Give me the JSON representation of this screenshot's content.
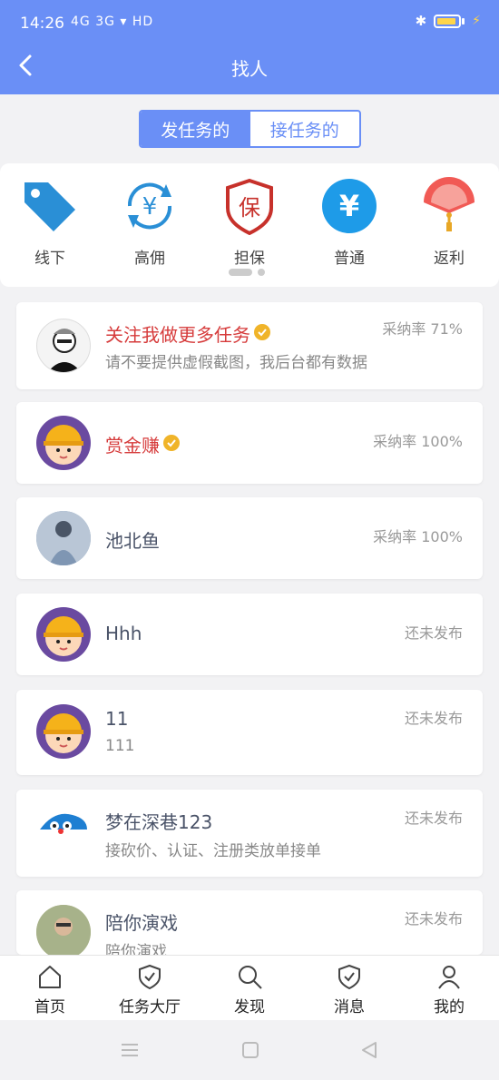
{
  "status_bar": {
    "time": "14:26",
    "signal_text": "4G 3G",
    "network": "HD"
  },
  "header": {
    "title": "找人"
  },
  "segment": {
    "tabs": [
      "发任务的",
      "接任务的"
    ],
    "active_index": 0
  },
  "categories": [
    {
      "label": "线下",
      "icon": "tag-icon"
    },
    {
      "label": "高佣",
      "icon": "yuan-refresh-icon"
    },
    {
      "label": "担保",
      "icon": "guarantee-shield-icon"
    },
    {
      "label": "普通",
      "icon": "yuan-circle-icon"
    },
    {
      "label": "返利",
      "icon": "fan-icon"
    }
  ],
  "users": [
    {
      "name": "关注我做更多任务",
      "verified": true,
      "red": true,
      "sub": "请不要提供虚假截图，我后台都有数据",
      "rate": "采纳率 71%"
    },
    {
      "name": "赏金赚",
      "verified": true,
      "red": true,
      "sub": "",
      "rate": "采纳率 100%"
    },
    {
      "name": "池北鱼",
      "verified": false,
      "red": false,
      "sub": "",
      "rate": "采纳率 100%"
    },
    {
      "name": "Hhh",
      "verified": false,
      "red": false,
      "sub": "",
      "rate": "还未发布"
    },
    {
      "name": "11",
      "verified": false,
      "red": false,
      "sub": "111",
      "rate": "还未发布"
    },
    {
      "name": "梦在深巷123",
      "verified": false,
      "red": false,
      "sub": "接砍价、认证、注册类放单接单",
      "rate": "还未发布"
    },
    {
      "name": "陪你演戏",
      "verified": false,
      "red": false,
      "sub": "陪你演戏",
      "rate": "还未发布"
    }
  ],
  "tabbar": {
    "items": [
      "首页",
      "任务大厅",
      "发现",
      "消息",
      "我的"
    ]
  },
  "colors": {
    "primary": "#6a8ff6",
    "red_name": "#d63b3b",
    "verified": "#f0b429"
  }
}
